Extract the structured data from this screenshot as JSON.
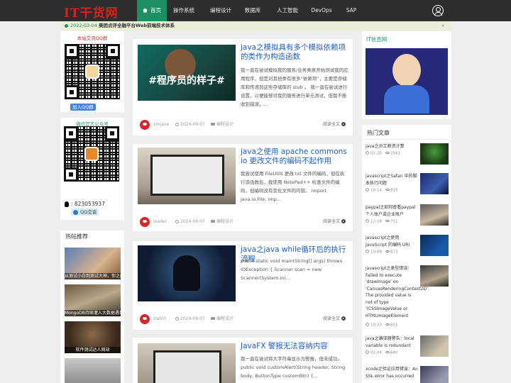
{
  "site": {
    "logo": "IT干货网"
  },
  "nav": {
    "items": [
      "首页",
      "操作系统",
      "编程设计",
      "数据库",
      "人工智能",
      "DevOps",
      "SAP"
    ]
  },
  "notice": {
    "date": "2022-03-04",
    "title": "美团点评全融平台Web前端技术体系",
    "close": "×"
  },
  "left": {
    "qq_group_caption": "本站交流QQ群",
    "qq_group_button": "加入QQ群",
    "wechat_caption": "微信官方公众号",
    "qq_number": ": 823053937",
    "qq_chat": "QQ交谈",
    "hot_title": "热帖推荐",
    "hot_items": [
      {
        "caption": "从测试小白到测试大神，你之间"
      },
      {
        "caption": "MongoDB持续灌入大数据遇到"
      },
      {
        "caption": "软件测试达人网站"
      },
      {
        "caption": ""
      }
    ]
  },
  "articles": [
    {
      "title": "java之模拟具有多个模拟依赖项的类作为构造函数",
      "desc": "我一直在尝试模拟我的服务/业务类来开始测试我的应用程序，但是对其他类有很多“依赖项”，主要是存储库和传递到这些存储库的 stub 。 我一直在尝试进行设置，以便能够对我的服务进行单元测试，但我不断收到错误，...",
      "author": "xmjava",
      "date": "2024-09-07",
      "category": "编程设计",
      "more": "阅读全文"
    },
    {
      "title": "java之使用 apache commons io 更改文件的编码不起作用",
      "desc": "我尝试使用 FileUtils 更改 txt 文件的编码，但在执行该函数后，我使用 NotePad++ 检查文件的编码，但编码没有变化文件的内容。 import java.io.File; imp...",
      "author": "leader",
      "date": "2024-09-07",
      "category": "编程设计",
      "more": "阅读全文"
    },
    {
      "title": "java之java while循环后的执行流程",
      "desc": "public static void main(String[] args) throws IOException { Scanner scan = new Scanner(System.in)...",
      "author": "zlatch",
      "date": "2024-09-07",
      "category": "编程设计",
      "more": "阅读全文"
    },
    {
      "title": "JavaFX 警报无法容纳内容",
      "desc": "我一直在尝试将大字符串显示为警报，但未成功。 public void customAlert(String header, String body, ButtonType customBtn) {...",
      "author": "",
      "date": "",
      "category": "",
      "more": ""
    }
  ],
  "right": {
    "it_title": "IT信息网",
    "hot_title": "热门文章",
    "items": [
      {
        "title": "java之员工薪资计算",
        "date": "02-25",
        "views": "2561"
      },
      {
        "title": "javascript之Safari 中的脚本执行问题",
        "date": "10-14",
        "views": "815"
      },
      {
        "title": "paypal之如何查看paypal个人账户或企业账户",
        "date": "12-18",
        "views": "711"
      },
      {
        "title": "javascript之使用 JavaScript 的编码 URI",
        "date": "10-09",
        "views": "673"
      },
      {
        "title": "javascript之类型错误：Failed to execute 'drawImage' on 'CanvasRenderingContext2D': The provided value is not of type '(CSSImageValue or HTMLImageElement",
        "date": "10-23",
        "views": "651"
      },
      {
        "title": "java之编译器警告：local variable is redundant",
        "date": "02-04",
        "views": "640"
      },
      {
        "title": "xcode之验证应用错误：An SSL error has occurred",
        "date": "",
        "views": ""
      }
    ]
  }
}
